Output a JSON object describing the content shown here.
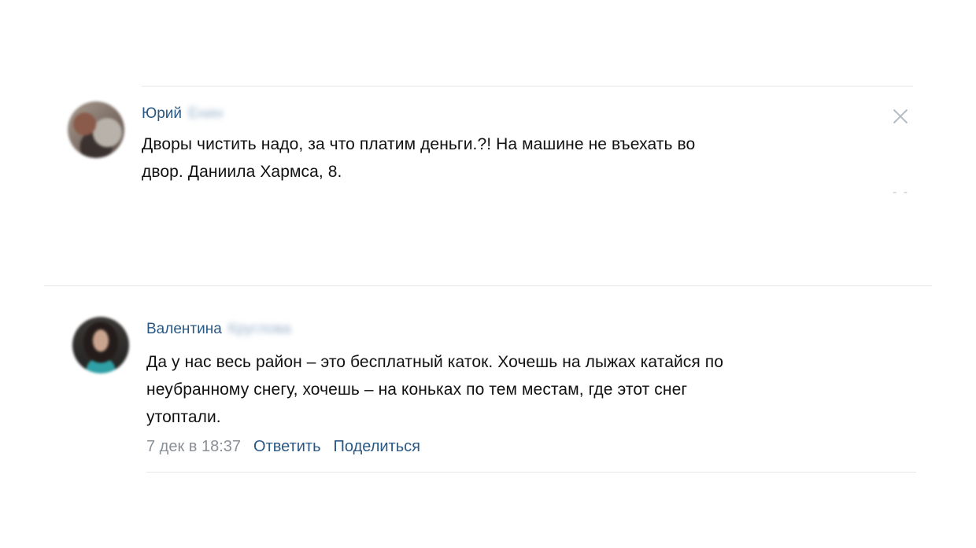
{
  "comments": [
    {
      "author_first": "Юрий",
      "author_last": "Енин",
      "text_line1": "Дворы чистить надо, за что платим деньги.?! На машине не въехать во",
      "text_line2": "двор. Даниила Хармса, 8.",
      "dots": "- -"
    },
    {
      "author_first": "Валентина",
      "author_last": "Круглова",
      "text_line1": "Да у нас весь район – это бесплатный каток. Хочешь на лыжах катайся по",
      "text_line2": "неубранному снегу, хочешь – на коньках по тем местам, где этот снег",
      "text_line3": "утоптали.",
      "date": "7 дек в 18:37",
      "reply_label": "Ответить",
      "share_label": "Поделиться"
    }
  ]
}
